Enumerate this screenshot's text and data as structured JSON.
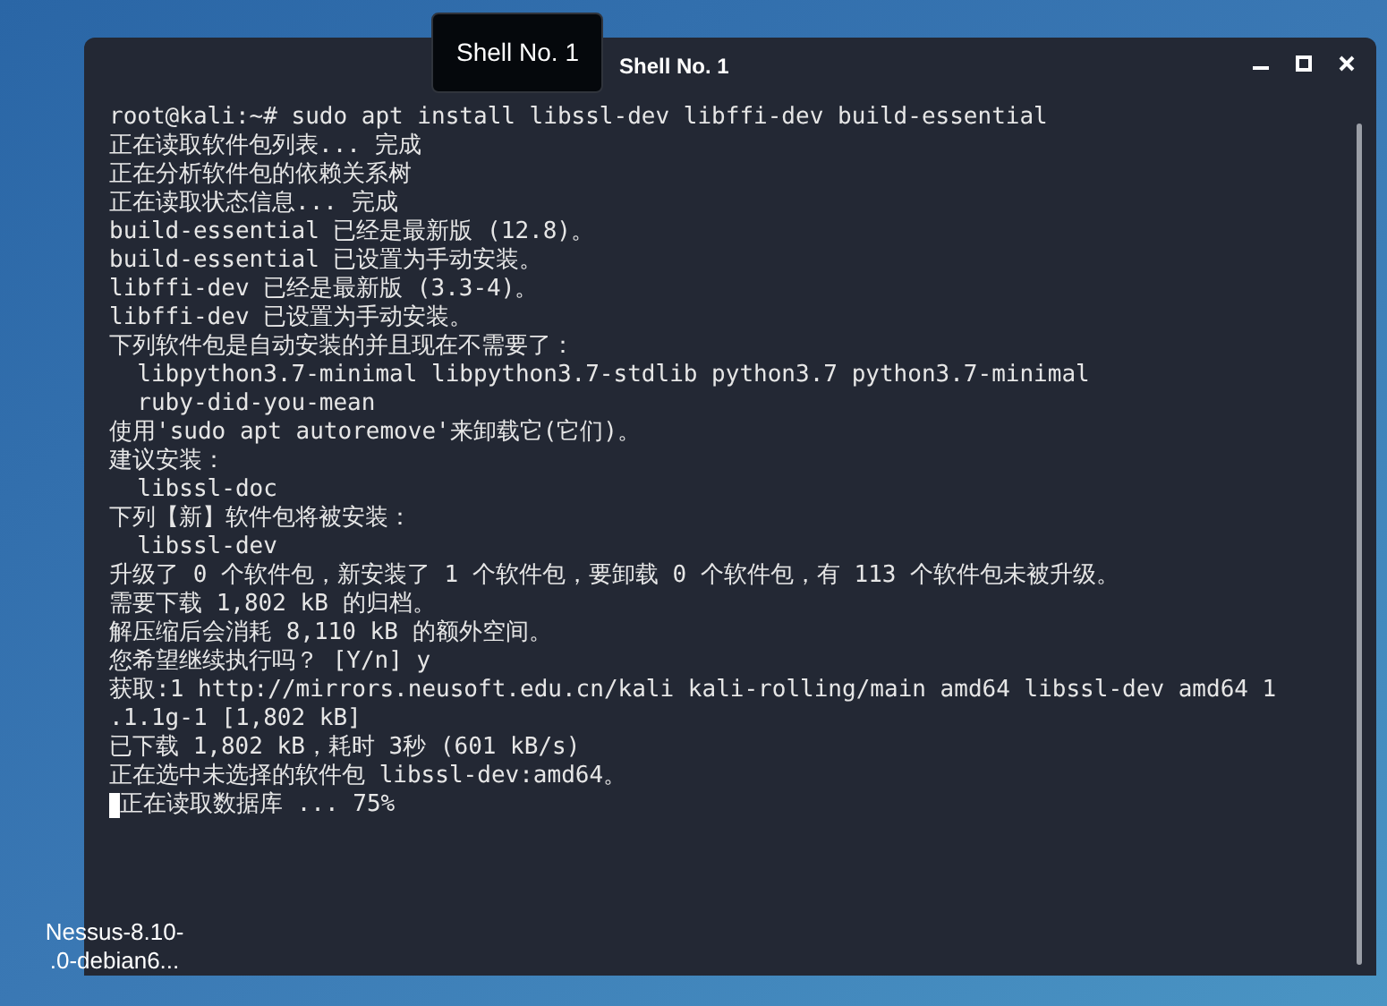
{
  "tooltip": {
    "text": "Shell No. 1"
  },
  "window": {
    "title": "Shell No. 1"
  },
  "terminal": {
    "lines": [
      "root@kali:~# sudo apt install libssl-dev libffi-dev build-essential",
      "正在读取软件包列表... 完成",
      "正在分析软件包的依赖关系树",
      "正在读取状态信息... 完成",
      "build-essential 已经是最新版 (12.8)。",
      "build-essential 已设置为手动安装。",
      "libffi-dev 已经是最新版 (3.3-4)。",
      "libffi-dev 已设置为手动安装。",
      "下列软件包是自动安装的并且现在不需要了：",
      "  libpython3.7-minimal libpython3.7-stdlib python3.7 python3.7-minimal",
      "  ruby-did-you-mean",
      "使用'sudo apt autoremove'来卸载它(它们)。",
      "建议安装：",
      "  libssl-doc",
      "下列【新】软件包将被安装：",
      "  libssl-dev",
      "升级了 0 个软件包，新安装了 1 个软件包，要卸载 0 个软件包，有 113 个软件包未被升级。",
      "需要下载 1,802 kB 的归档。",
      "解压缩后会消耗 8,110 kB 的额外空间。",
      "您希望继续执行吗？ [Y/n] y",
      "获取:1 http://mirrors.neusoft.edu.cn/kali kali-rolling/main amd64 libssl-dev amd64 1",
      ".1.1g-1 [1,802 kB]",
      "已下载 1,802 kB，耗时 3秒 (601 kB/s)",
      "正在选中未选择的软件包 libssl-dev:amd64。",
      "正在读取数据库 ... 75%"
    ],
    "cursor_on_last_line": true
  },
  "desktop_icon": {
    "label_lines": [
      "Nessus-8.10-",
      ".0-debian6..."
    ]
  }
}
